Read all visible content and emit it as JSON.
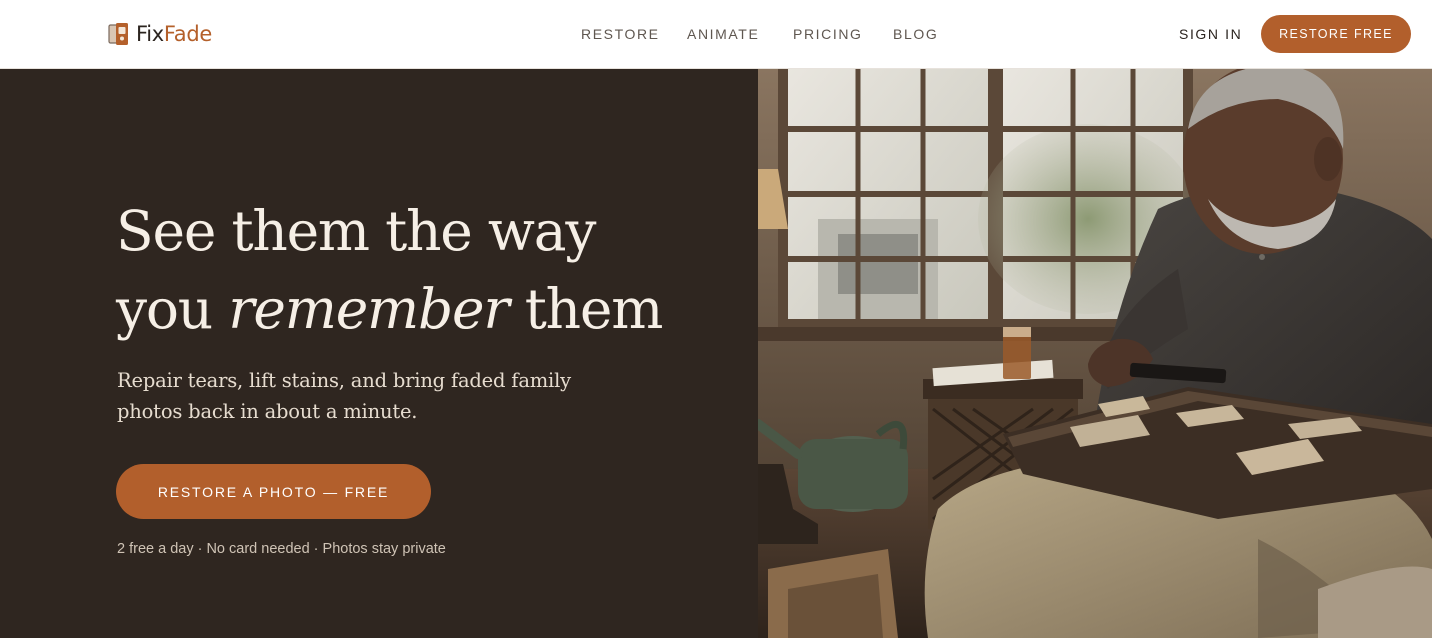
{
  "header": {
    "logo": {
      "part1": "Fix",
      "part2": "Fade",
      "icon": "photo-frame-icon"
    },
    "nav": [
      {
        "label": "RESTORE"
      },
      {
        "label": "ANIMATE"
      },
      {
        "label": "PRICING"
      },
      {
        "label": "BLOG"
      }
    ],
    "sign_in": "SIGN IN",
    "cta": "RESTORE FREE"
  },
  "hero": {
    "headline": {
      "line1": "See them the way",
      "line2_start": "you ",
      "line2_em": "remember",
      "line2_end": " them"
    },
    "subhead": "Repair tears, lift stains, and bring faded family photos back in about a minute.",
    "cta": "RESTORE A PHOTO — FREE",
    "fineprint": "2 free a day · No card needed · Photos stay private"
  },
  "colors": {
    "accent": "#b25f2c",
    "hero_bg": "#2f2620",
    "headline": "#f6efe6",
    "nav_text": "#5f5750"
  }
}
